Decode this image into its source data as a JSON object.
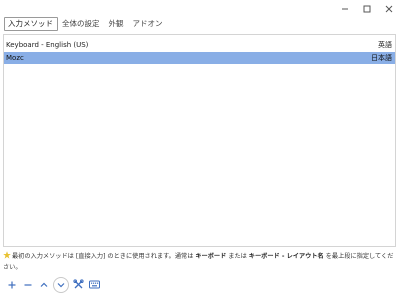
{
  "window": {
    "controls": [
      "minimize",
      "maximize",
      "close"
    ]
  },
  "tabs": [
    {
      "label": "入力メソッド",
      "active": true
    },
    {
      "label": "全体の設定",
      "active": false
    },
    {
      "label": "外観",
      "active": false
    },
    {
      "label": "アドオン",
      "active": false
    }
  ],
  "input_methods": [
    {
      "name": "Keyboard - English (US)",
      "language": "英語",
      "selected": false
    },
    {
      "name": "Mozc",
      "language": "日本語",
      "selected": true
    }
  ],
  "hint": {
    "part1": "最初の入力メソッドは [直接入力] のときに使用されます。通常は ",
    "bold1": "キーボード",
    "part2": " または ",
    "bold2": "キーボード - レイアウト名",
    "part3": " を最上段に指定してください。"
  },
  "toolbar": {
    "buttons": [
      "add-icon",
      "remove-icon",
      "move-up-icon",
      "move-down-icon",
      "configure-icon",
      "keyboard-layout-icon"
    ]
  },
  "colors": {
    "selection": "#89aee6",
    "accent": "#3f6fbf"
  }
}
